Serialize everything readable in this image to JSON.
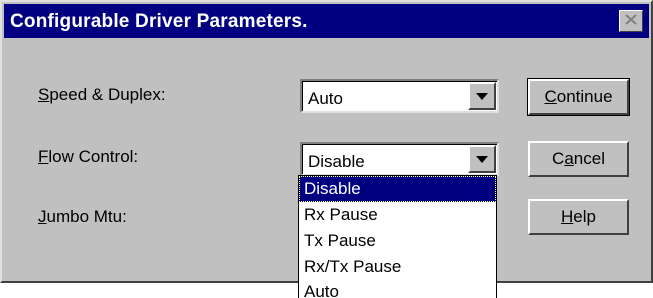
{
  "window": {
    "title": "Configurable Driver Parameters.",
    "close_icon": "close-icon"
  },
  "fields": [
    {
      "label_prefix": "",
      "label_mnemonic": "S",
      "label_rest": "peed & Duplex:",
      "value": "Auto"
    },
    {
      "label_prefix": "",
      "label_mnemonic": "F",
      "label_rest": "low Control:",
      "value": "Disable"
    },
    {
      "label_prefix": "",
      "label_mnemonic": "J",
      "label_rest": "umbo Mtu:"
    }
  ],
  "buttons": {
    "continue": {
      "prefix": "",
      "mnemonic": "C",
      "rest": "ontinue"
    },
    "cancel": {
      "prefix": "C",
      "mnemonic": "a",
      "rest": "ncel"
    },
    "help": {
      "prefix": "",
      "mnemonic": "H",
      "rest": "elp"
    }
  },
  "flow_control_dropdown": {
    "options": [
      "Disable",
      "Rx Pause",
      "Tx Pause",
      "Rx/Tx Pause",
      "Auto"
    ],
    "highlighted": "Disable"
  },
  "colors": {
    "title_bar": "#000080",
    "face": "#c0c0c0",
    "highlight": "#000080"
  }
}
